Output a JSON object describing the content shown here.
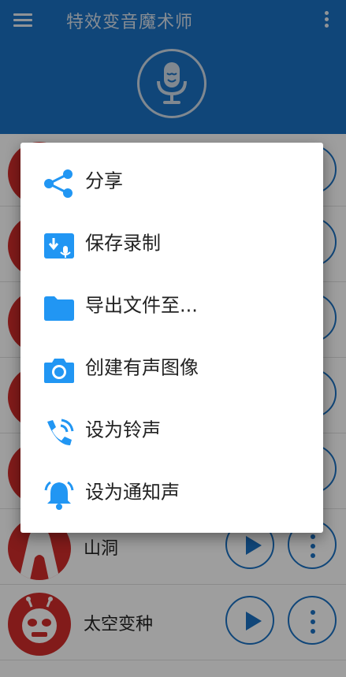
{
  "app": {
    "title": "特效变音魔术师"
  },
  "colors": {
    "primary": "#1a72c4",
    "accent_icon": "#2196f3",
    "avatar_red": "#d22d2b"
  },
  "list": {
    "rows": [
      {
        "name": ""
      },
      {
        "name": ""
      },
      {
        "name": ""
      },
      {
        "name": ""
      },
      {
        "name": ""
      },
      {
        "name": "山洞"
      },
      {
        "name": "太空变种"
      }
    ]
  },
  "menu": {
    "items": [
      {
        "label": "分享",
        "icon": "share-icon"
      },
      {
        "label": "保存录制",
        "icon": "save-recording-icon"
      },
      {
        "label": "导出文件至...",
        "icon": "folder-icon"
      },
      {
        "label": "创建有声图像",
        "icon": "camera-icon"
      },
      {
        "label": "设为铃声",
        "icon": "phone-ringtone-icon"
      },
      {
        "label": "设为通知声",
        "icon": "bell-icon"
      }
    ]
  }
}
